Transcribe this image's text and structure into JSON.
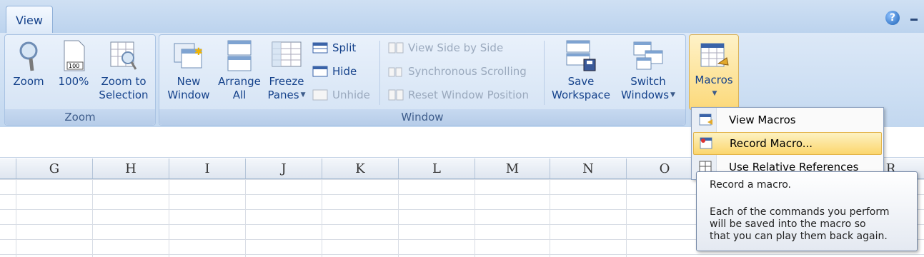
{
  "tabs": {
    "view": "View"
  },
  "window_controls": {
    "help": "?"
  },
  "groups": {
    "zoom": {
      "label": "Zoom",
      "buttons": {
        "zoom": "Zoom",
        "hundred": "100%",
        "zoom_to_line1": "Zoom to",
        "zoom_to_line2": "Selection"
      }
    },
    "window": {
      "label": "Window",
      "new_window_line1": "New",
      "new_window_line2": "Window",
      "arrange_line1": "Arrange",
      "arrange_line2": "All",
      "freeze_line1": "Freeze",
      "freeze_line2": "Panes",
      "split": "Split",
      "hide": "Hide",
      "unhide": "Unhide",
      "view_side": "View Side by Side",
      "sync_scroll": "Synchronous Scrolling",
      "reset_pos": "Reset Window Position",
      "save_ws_line1": "Save",
      "save_ws_line2": "Workspace",
      "switch_line1": "Switch",
      "switch_line2": "Windows"
    },
    "macros": {
      "label": "Macros"
    }
  },
  "columns": [
    "G",
    "H",
    "I",
    "J",
    "K",
    "L",
    "M",
    "N",
    "O",
    "R"
  ],
  "macros_menu": {
    "items": [
      {
        "label": "View Macros",
        "icon": "view-macros-icon"
      },
      {
        "label": "Record Macro...",
        "icon": "record-macro-icon"
      },
      {
        "label": "Use Relative References",
        "icon": "relative-references-icon"
      }
    ]
  },
  "tooltip": {
    "title": "Record a macro.",
    "body": "Each of the commands you perform\nwill be saved into the macro so\nthat you can play them back again."
  },
  "colors": {
    "ribbon_text": "#15428b",
    "highlight": "#fbd66d"
  }
}
